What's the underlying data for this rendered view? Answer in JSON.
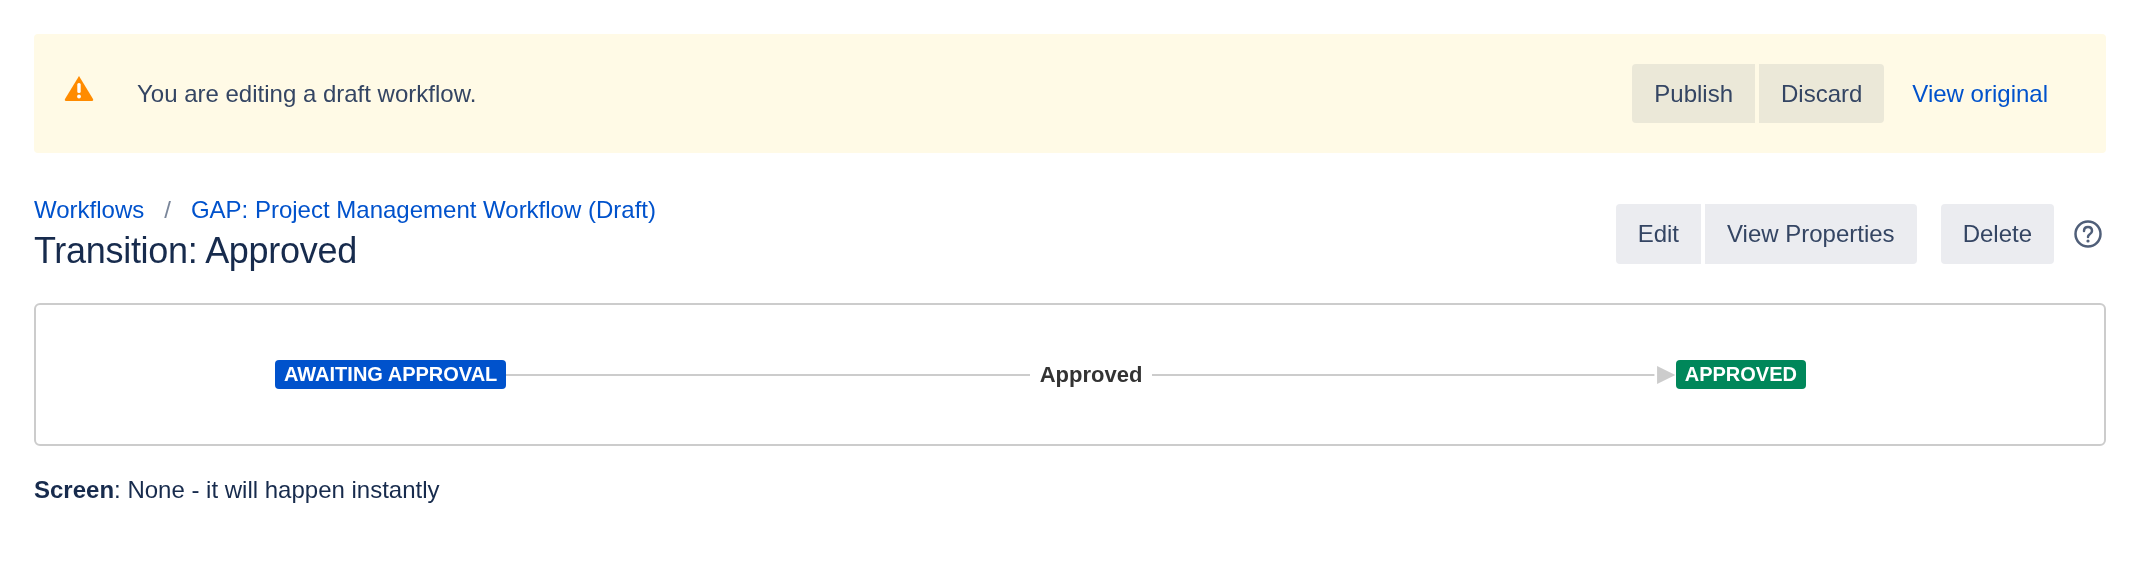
{
  "banner": {
    "message": "You are editing a draft workflow.",
    "buttons": [
      {
        "label": "Publish"
      },
      {
        "label": "Discard"
      }
    ],
    "link": "View original"
  },
  "breadcrumbs": [
    "Workflows",
    "GAP: Project Management Workflow (Draft)"
  ],
  "breadcrumb_separator": "/",
  "title": "Transition: Approved",
  "actions": {
    "group": [
      {
        "label": "Edit"
      },
      {
        "label": "View Properties"
      }
    ],
    "delete": "Delete"
  },
  "diagram": {
    "from": {
      "label": "AWAITING APPROVAL",
      "color": "#0052cc"
    },
    "transition": "Approved",
    "to": {
      "label": "APPROVED",
      "color": "#00875a"
    }
  },
  "screen_info": "**Screen**: None - it will happen instantly"
}
